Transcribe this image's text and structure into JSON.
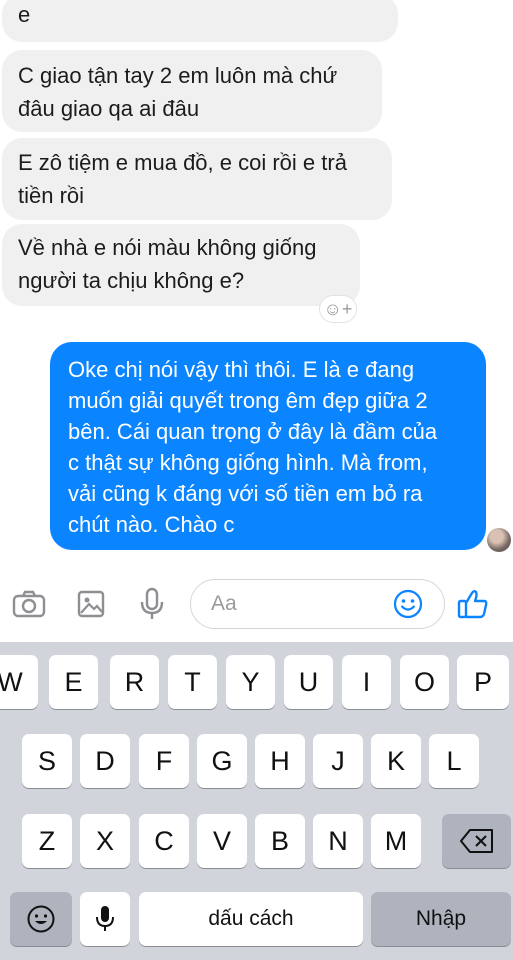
{
  "messages_incoming": [
    {
      "text": "e"
    },
    {
      "text": "C giao tận tay 2 em luôn mà chứ\nđâu giao qa ai đâu"
    },
    {
      "text": "E zô tiệm e mua đồ, e coi rồi e trả\ntiền rồi"
    },
    {
      "text": "Về nhà e nói màu không giống\nngười ta chịu không e?"
    }
  ],
  "message_outgoing": {
    "text": "Oke chị nói vậy thì thôi. E là e đang\nmuốn giải quyết trong êm đẹp giữa 2\nbên. Cái quan trọng ở đây là đầm của\nc thật sự không giống hình. Mà from,\nvải cũng k đáng với số tiền em bỏ ra\nchút nào. Chào c"
  },
  "reaction_button": {
    "label": "☺+"
  },
  "composer": {
    "placeholder": "Aa"
  },
  "toolbar_icons": [
    "camera-icon",
    "gallery-icon",
    "microphone-icon",
    "emoji-icon",
    "thumbs-up-icon"
  ],
  "keyboard": {
    "row1": [
      "W",
      "E",
      "R",
      "T",
      "Y",
      "U",
      "I",
      "O",
      "P"
    ],
    "row2": [
      "S",
      "D",
      "F",
      "G",
      "H",
      "J",
      "K",
      "L"
    ],
    "row3": [
      "Z",
      "X",
      "C",
      "V",
      "B",
      "N",
      "M"
    ],
    "space_label": "dấu cách",
    "return_label": "Nhập"
  },
  "colors": {
    "outgoing_bubble": "#0a84ff",
    "incoming_bubble": "#f0f0f0",
    "accent": "#0a84ff",
    "keyboard_bg": "#d1d5db"
  }
}
